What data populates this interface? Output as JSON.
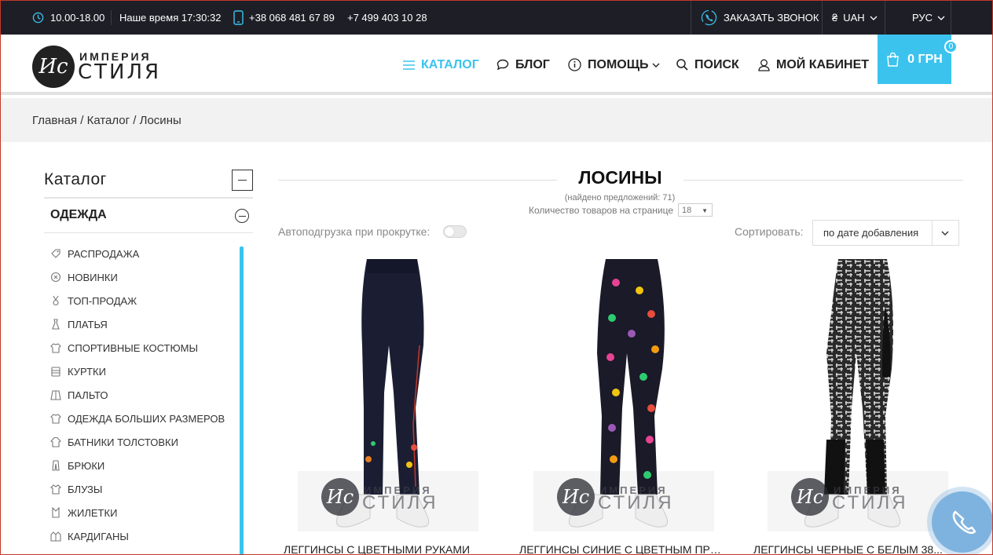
{
  "topbar": {
    "hours": "10.00-18.00",
    "our_time_label": "Наше время 17:30:32",
    "phone1": "+38 068 481 67 89",
    "phone2": "+7  499 403 10 28",
    "callback": "ЗАКАЗАТЬ ЗВОНОК",
    "currency_symbol": "₴",
    "currency": "UAH",
    "language": "РУС"
  },
  "logo": {
    "line1": "ИМПЕРИЯ",
    "line2": "СТИЛЯ",
    "monogram": "Ис"
  },
  "nav": {
    "catalog": "КАТАЛОГ",
    "blog": "БЛОГ",
    "help": "ПОМОЩЬ",
    "search": "ПОИСК",
    "account": "МОЙ КАБИНЕТ",
    "cart": "0 ГРН",
    "cart_count": "0"
  },
  "breadcrumb": "Главная / Каталог / Лосины",
  "sidebar": {
    "title": "Каталог",
    "category": "ОДЕЖДА",
    "items": [
      {
        "label": "РАСПРОДАЖА",
        "icon": "tag-icon"
      },
      {
        "label": "НОВИНКИ",
        "icon": "new-icon"
      },
      {
        "label": "ТОП-ПРОДАЖ",
        "icon": "medal-icon"
      },
      {
        "label": "ПЛАТЬЯ",
        "icon": "dress-icon"
      },
      {
        "label": "СПОРТИВНЫЕ КОСТЮМЫ",
        "icon": "tracksuit-icon"
      },
      {
        "label": "КУРТКИ",
        "icon": "jacket-icon"
      },
      {
        "label": "ПАЛЬТО",
        "icon": "coat-icon"
      },
      {
        "label": "ОДЕЖДА БОЛЬШИХ РАЗМЕРОВ",
        "icon": "plus-size-icon"
      },
      {
        "label": "БАТНИКИ ТОЛСТОВКИ",
        "icon": "hoodie-icon"
      },
      {
        "label": "БРЮКИ",
        "icon": "pants-icon"
      },
      {
        "label": "БЛУЗЫ",
        "icon": "blouse-icon"
      },
      {
        "label": "ЖИЛЕТКИ",
        "icon": "vest-icon"
      },
      {
        "label": "КАРДИГАНЫ",
        "icon": "cardigan-icon"
      }
    ]
  },
  "main": {
    "title": "ЛОСИНЫ",
    "found": "(найдено предложений: 71)",
    "per_page_label": "Количество товаров на странице",
    "per_page_value": "18",
    "autoload_label": "Автоподгрузка при прокрутке:",
    "sort_label": "Сортировать:",
    "sort_value": "по дате добавления"
  },
  "products": [
    {
      "name": "ЛЕГГИНСЫ С ЦВЕТНЫМИ РУКАМИ"
    },
    {
      "name": "ЛЕГГИНСЫ СИНИЕ С ЦВЕТНЫМ ПРИНТОМ"
    },
    {
      "name": "ЛЕГГИНСЫ ЧЕРНЫЕ С БЕЛЫМ 38..."
    }
  ],
  "colors": {
    "accent": "#3bc3ee",
    "topbar": "#1e1f26"
  }
}
